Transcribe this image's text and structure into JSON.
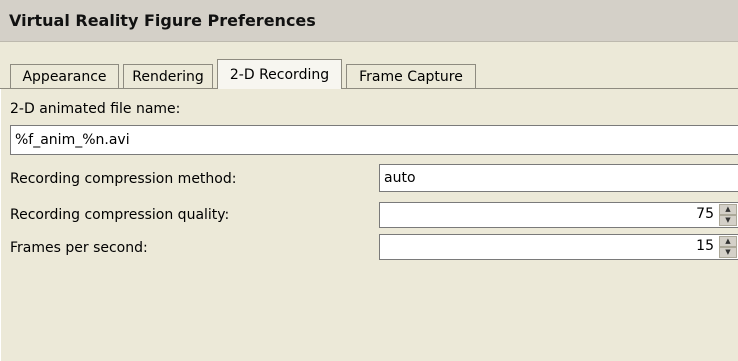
{
  "window": {
    "title": "Virtual Reality Figure Preferences"
  },
  "tabs": [
    {
      "label": "Appearance",
      "active": false
    },
    {
      "label": "Rendering",
      "active": false
    },
    {
      "label": "2-D Recording",
      "active": true
    },
    {
      "label": "Frame Capture",
      "active": false
    }
  ],
  "form": {
    "file_name_label": "2-D animated file name:",
    "file_name_value": "%f_anim_%n.avi",
    "compression_method_label": "Recording compression method:",
    "compression_method_value": "auto",
    "compression_quality_label": "Recording compression quality:",
    "compression_quality_value": "75",
    "fps_label": "Frames per second:",
    "fps_value": "15"
  },
  "colors": {
    "window_bg": "#ece9d8",
    "title_bar_bg": "#d4d0c8",
    "active_tab_bg": "#f7f6f0"
  }
}
